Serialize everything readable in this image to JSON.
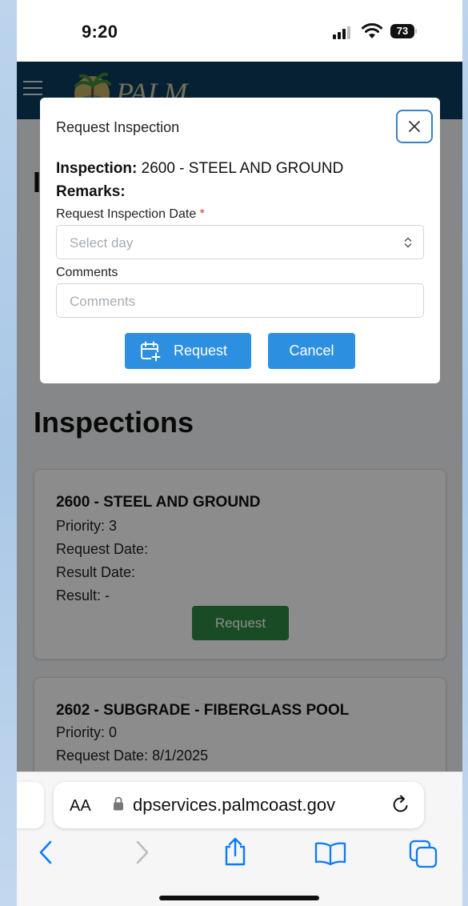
{
  "status_bar": {
    "time": "9:20",
    "battery": "73"
  },
  "header": {
    "logo_text": "PALM COAST"
  },
  "page": {
    "heading_initial": "I",
    "section_title": "Inspections",
    "cards": [
      {
        "title": "2600 - STEEL AND GROUND",
        "priority": "Priority: 3",
        "request_date": "Request Date:",
        "result_date": "Result Date:",
        "result": "Result: -",
        "button_label": "Request"
      },
      {
        "title": "2602 - SUBGRADE - FIBERGLASS POOL",
        "priority": "Priority: 0",
        "request_date": "Request Date: 8/1/2025"
      }
    ]
  },
  "modal": {
    "title": "Request Inspection",
    "inspection_label": "Inspection:",
    "inspection_value": "2600 - STEEL AND GROUND",
    "remarks_label": "Remarks:",
    "date_label": "Request Inspection Date",
    "required_marker": "*",
    "date_placeholder": "Select day",
    "comments_label": "Comments",
    "comments_placeholder": "Comments",
    "request_button": "Request",
    "cancel_button": "Cancel"
  },
  "browser": {
    "text_size_label": "AA",
    "url": "dpservices.palmcoast.gov"
  },
  "colors": {
    "header_bg": "#0b3d5e",
    "primary_button": "#2d8fe0",
    "success_button": "#2e8b44",
    "close_border": "#3a82c9",
    "required_star": "#dd3333",
    "safari_blue": "#0a7aff"
  },
  "icons": [
    "signal-icon",
    "wifi-icon",
    "battery-icon",
    "menu-icon",
    "close-icon",
    "chevron-updown-icon",
    "calendar-plus-icon",
    "lock-icon",
    "reload-icon",
    "back-icon",
    "forward-icon",
    "share-icon",
    "bookmarks-icon",
    "tabs-icon"
  ]
}
